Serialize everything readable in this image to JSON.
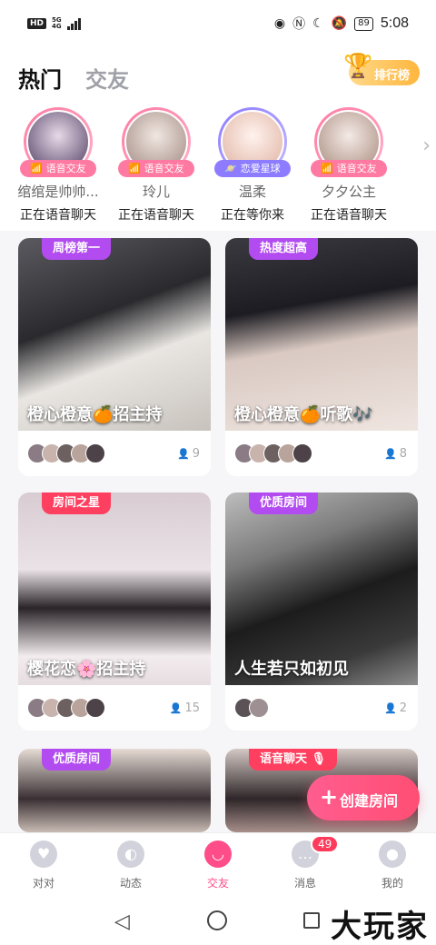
{
  "status_bar": {
    "hd": "HD",
    "network": "5G",
    "network_sub": "4G",
    "battery": "89",
    "time": "5:08"
  },
  "header": {
    "tabs": [
      {
        "label": "热门",
        "active": true
      },
      {
        "label": "交友",
        "active": false
      }
    ],
    "rank_label": "排行榜"
  },
  "stories": [
    {
      "name": "绾绾是帅帅...",
      "badge": "语音交友",
      "status": "正在语音聊天",
      "ring": "#ff7aa2",
      "badge_color": "#ff7aa2"
    },
    {
      "name": "玲儿",
      "badge": "语音交友",
      "status": "正在语音聊天",
      "ring": "#ff7aa2",
      "badge_color": "#ff7aa2"
    },
    {
      "name": "温柔",
      "badge": "恋爱星球",
      "status": "正在等你来",
      "ring": "#8d7cff",
      "badge_color": "#8d7cff"
    },
    {
      "name": "夕夕公主",
      "badge": "语音交友",
      "status": "正在语音聊天",
      "ring": "#ff7aa2",
      "badge_color": "#ff7aa2"
    }
  ],
  "cards": [
    {
      "tag": "周榜第一",
      "tag_color": "#b34cf0",
      "title": "橙心橙意🍊招主持",
      "count": "9",
      "avatars": 5
    },
    {
      "tag": "热度超高",
      "tag_color": "#b34cf0",
      "title": "橙心橙意🍊听歌🎶",
      "count": "8",
      "avatars": 5
    },
    {
      "tag": "房间之星",
      "tag_color": "#ff3f5f",
      "title": "樱花恋🌸招主持",
      "count": "15",
      "avatars": 5
    },
    {
      "tag": "优质房间",
      "tag_color": "#b34cf0",
      "title": "人生若只如初见",
      "count": "2",
      "avatars": 2
    },
    {
      "tag": "优质房间",
      "tag_color": "#b34cf0",
      "title": "",
      "count": "",
      "avatars": 0
    },
    {
      "tag": "语音聊天 🎙",
      "tag_color": "#ff3f5f",
      "title": "",
      "count": "",
      "avatars": 0
    }
  ],
  "fab": {
    "label": "创建房间"
  },
  "bottom_nav": [
    {
      "label": "对对",
      "icon": "heart-icon",
      "active": false
    },
    {
      "label": "动态",
      "icon": "planet-icon",
      "active": false
    },
    {
      "label": "交友",
      "icon": "smile-bag-icon",
      "active": true
    },
    {
      "label": "消息",
      "icon": "chat-icon",
      "active": false,
      "badge": "49"
    },
    {
      "label": "我的",
      "icon": "profile-icon",
      "active": false
    }
  ],
  "watermark": "大玩家"
}
